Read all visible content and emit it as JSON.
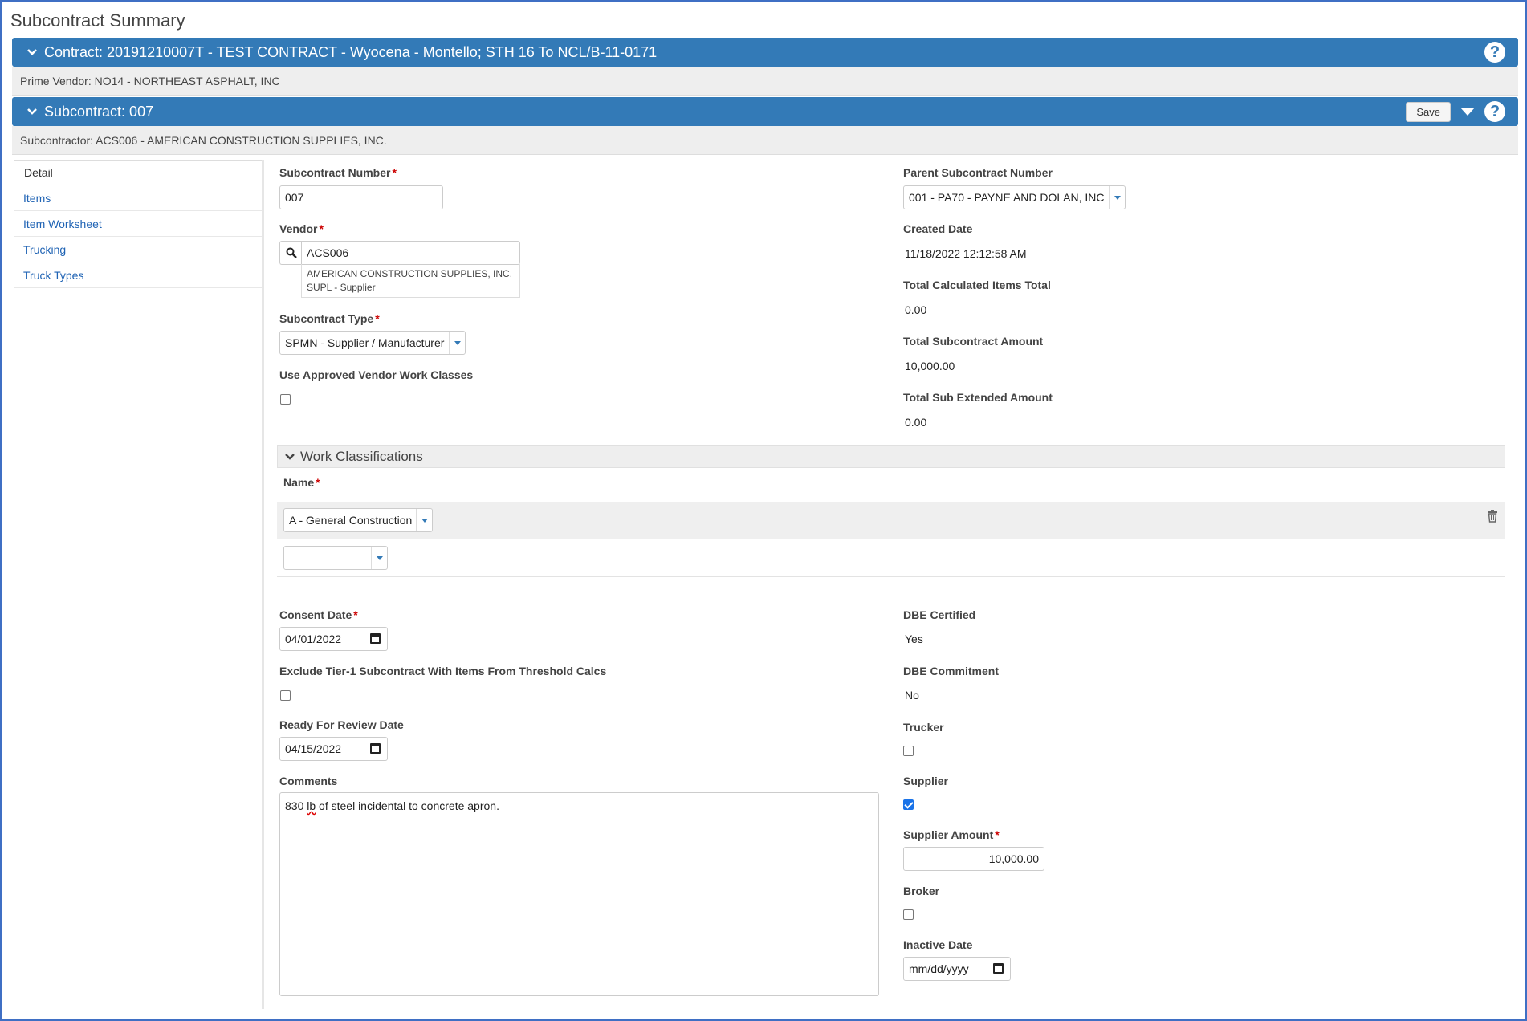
{
  "page": {
    "title": "Subcontract Summary"
  },
  "contract_bar": {
    "title": "Contract: 20191210007T - TEST CONTRACT - Wyocena - Montello; STH 16 To NCL/B-11-0171",
    "prime_vendor": "Prime Vendor: NO14 - NORTHEAST ASPHALT, INC"
  },
  "subcontract_bar": {
    "title": "Subcontract: 007",
    "save_label": "Save",
    "subcontractor": "Subcontractor: ACS006 - AMERICAN CONSTRUCTION SUPPLIES, INC."
  },
  "sidebar": {
    "items": [
      {
        "label": "Detail",
        "active": true
      },
      {
        "label": "Items"
      },
      {
        "label": "Item Worksheet"
      },
      {
        "label": "Trucking"
      },
      {
        "label": "Truck Types"
      }
    ]
  },
  "detail": {
    "subcontract_number_label": "Subcontract Number",
    "subcontract_number": "007",
    "vendor_label": "Vendor",
    "vendor_value": "ACS006",
    "vendor_name": "AMERICAN CONSTRUCTION SUPPLIES, INC.",
    "vendor_type": "SUPL - Supplier",
    "subcontract_type_label": "Subcontract Type",
    "subcontract_type": "SPMN - Supplier / Manufacturer",
    "use_approved_label": "Use Approved Vendor Work Classes",
    "parent_label": "Parent Subcontract Number",
    "parent_value": "001 - PA70 - PAYNE AND DOLAN, INC",
    "created_label": "Created Date",
    "created_value": "11/18/2022 12:12:58 AM",
    "calc_total_label": "Total Calculated Items Total",
    "calc_total_value": "0.00",
    "sub_amount_label": "Total Subcontract Amount",
    "sub_amount_value": "10,000.00",
    "sub_ext_label": "Total Sub Extended Amount",
    "sub_ext_value": "0.00"
  },
  "work_classifications": {
    "title": "Work Classifications",
    "name_label": "Name",
    "rows": [
      "A - General Construction"
    ]
  },
  "lower": {
    "consent_label": "Consent Date",
    "consent_value": "04/01/2022",
    "exclude_label": "Exclude Tier-1 Subcontract With Items From Threshold Calcs",
    "review_label": "Ready For Review Date",
    "review_value": "04/15/2022",
    "comments_label": "Comments",
    "comments_pre": "830 ",
    "comments_spell": "lb",
    "comments_post": " of steel incidental to concrete apron.",
    "dbe_cert_label": "DBE Certified",
    "dbe_cert_value": "Yes",
    "dbe_commit_label": "DBE Commitment",
    "dbe_commit_value": "No",
    "trucker_label": "Trucker",
    "supplier_label": "Supplier",
    "supplier_amount_label": "Supplier Amount",
    "supplier_amount_value": "10,000.00",
    "broker_label": "Broker",
    "inactive_label": "Inactive Date",
    "inactive_placeholder": "mm/dd/yyyy"
  },
  "colors": {
    "header_blue": "#337ab7",
    "link_blue": "#1f63b4",
    "required_red": "#cc0000"
  }
}
